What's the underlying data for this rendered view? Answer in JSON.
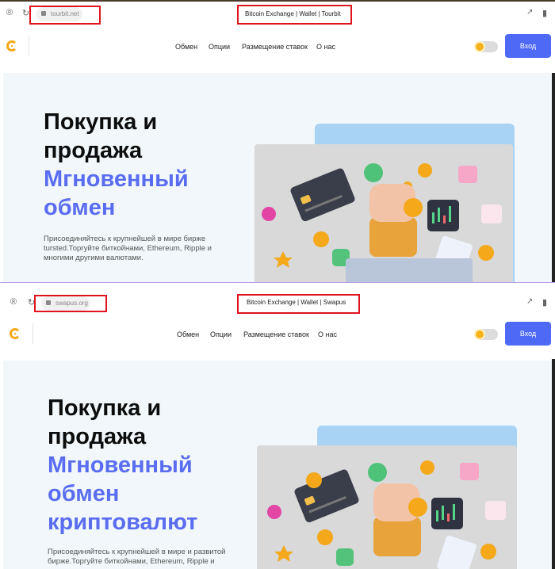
{
  "screenshots": [
    {
      "url": "tourbit.net",
      "page_title": "Bitcoin Exchange | Wallet | Tourbit",
      "nav": [
        "Обмен",
        "Опции",
        "Размещение ставок",
        "О нас"
      ],
      "login_label": "Вход",
      "headline_dark": [
        "Покупка и",
        "продажа"
      ],
      "headline_accent": [
        "Мгновенный",
        "обмен"
      ],
      "description": "Присоединяйтесь к крупнейшей в мире бирже tursted.Торгуйте биткойнами, Ethereum, Ripple и многими другими валютами."
    },
    {
      "url": "swapus.org",
      "page_title": "Bitcoin Exchange | Wallet | Swapus",
      "nav": [
        "Обмен",
        "Опции",
        "Размещение ставок",
        "О нас"
      ],
      "login_label": "Вход",
      "headline_dark": [
        "Покупка и",
        "продажа"
      ],
      "headline_accent": [
        "Мгновенный",
        "обмен",
        "криптовалют"
      ],
      "description": "Присоединяйтесь к крупнейшей в мире и развитой бирже.Торгуйте биткойнами, Ethereum, Ripple и"
    }
  ],
  "colors": {
    "accent": "#5a6cf0",
    "button": "#4e69f5",
    "highlight_box": "#e0141e",
    "coin": "#f4a81a"
  },
  "icons": [
    "reload-icon",
    "back-icon",
    "lock-icon",
    "share-icon",
    "bookmark-icon",
    "coin-logo-icon"
  ]
}
